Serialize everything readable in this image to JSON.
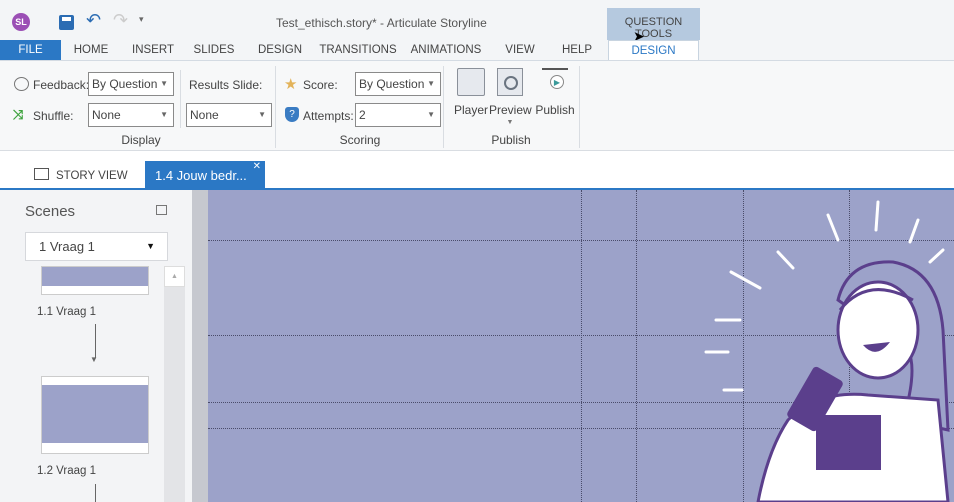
{
  "app": {
    "title": "Test_ethisch.story* -  Articulate Storyline",
    "logo": "SL",
    "contextual_group": "QUESTION TOOLS"
  },
  "quick_access": {
    "icons": [
      "save-icon",
      "undo-icon",
      "redo-icon",
      "customize-icon"
    ]
  },
  "tabs": [
    "FILE",
    "HOME",
    "INSERT",
    "SLIDES",
    "DESIGN",
    "TRANSITIONS",
    "ANIMATIONS",
    "VIEW",
    "HELP",
    "DESIGN"
  ],
  "ribbon": {
    "display": {
      "feedback_label": "Feedback:",
      "feedback_value": "By Question",
      "shuffle_label": "Shuffle:",
      "shuffle_value": "None",
      "results_label": "Results Slide:",
      "results_value": "None",
      "group": "Display"
    },
    "scoring": {
      "score_label": "Score:",
      "score_value": "By Question",
      "attempts_label": "Attempts:",
      "attempts_value": "2",
      "group": "Scoring"
    },
    "publish": {
      "player": "Player",
      "preview": "Preview",
      "publish": "Publish",
      "group": "Publish"
    }
  },
  "view_tabs": {
    "story_view": "STORY VIEW",
    "slide_tab": "1.4 Jouw bedr..."
  },
  "scenes": {
    "title": "Scenes",
    "selected": "1 Vraag 1",
    "slides": [
      "1.1 Vraag 1",
      "1.2 Vraag 1"
    ]
  },
  "colors": {
    "accent": "#2b78c5",
    "canvas": "#9ca2c9",
    "illustration": "#5b3f8c"
  }
}
